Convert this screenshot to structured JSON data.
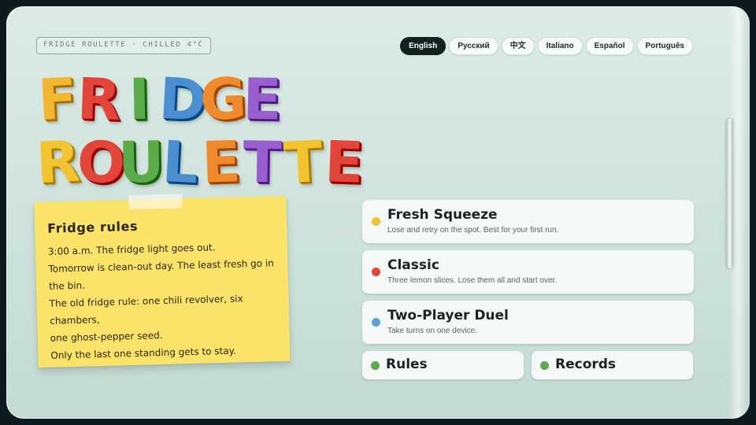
{
  "status_tag": "FRIDGE ROULETTE · CHILLED 4°C",
  "languages": [
    {
      "label": "English",
      "active": true
    },
    {
      "label": "Русский",
      "active": false
    },
    {
      "label": "中文",
      "active": false
    },
    {
      "label": "Italiano",
      "active": false
    },
    {
      "label": "Español",
      "active": false
    },
    {
      "label": "Português",
      "active": false
    }
  ],
  "title": {
    "line1": [
      {
        "char": "F",
        "color": "#f2b630"
      },
      {
        "char": "R",
        "color": "#e2453a"
      },
      {
        "char": "I",
        "color": "#5bab4a"
      },
      {
        "char": "D",
        "color": "#4b8fd0"
      },
      {
        "char": "G",
        "color": "#ef8b2c"
      },
      {
        "char": "E",
        "color": "#9a5fcf"
      }
    ],
    "line2": [
      {
        "char": "R",
        "color": "#f2c432"
      },
      {
        "char": "O",
        "color": "#e2453a"
      },
      {
        "char": "U",
        "color": "#5bab4a"
      },
      {
        "char": "L",
        "color": "#4b8fd0"
      },
      {
        "char": "E",
        "color": "#ef8b2c"
      },
      {
        "char": "T",
        "color": "#9a5fcf"
      },
      {
        "char": "T",
        "color": "#f2c432"
      },
      {
        "char": "E",
        "color": "#e2453a"
      }
    ]
  },
  "note": {
    "title": "Fridge rules",
    "lines": [
      "3:00 a.m. The fridge light goes out.",
      "Tomorrow is clean-out day. The least fresh go in",
      "the bin.",
      "The old fridge rule: one chili revolver, six chambers,",
      "one ghost-pepper seed.",
      "Only the last one standing gets to stay."
    ]
  },
  "modes": [
    {
      "title": "Fresh Squeeze",
      "subtitle": "Lose and retry on the spot. Best for your first run.",
      "dot_color": "#f2c432"
    },
    {
      "title": "Classic",
      "subtitle": "Three lemon slices. Lose them all and start over.",
      "dot_color": "#e2453a"
    },
    {
      "title": "Two-Player Duel",
      "subtitle": "Take turns on one device.",
      "dot_color": "#5b9fd6"
    }
  ],
  "extras": [
    {
      "title": "Rules",
      "dot_color": "#5bab4a"
    },
    {
      "title": "Records",
      "dot_color": "#5bab4a"
    }
  ]
}
